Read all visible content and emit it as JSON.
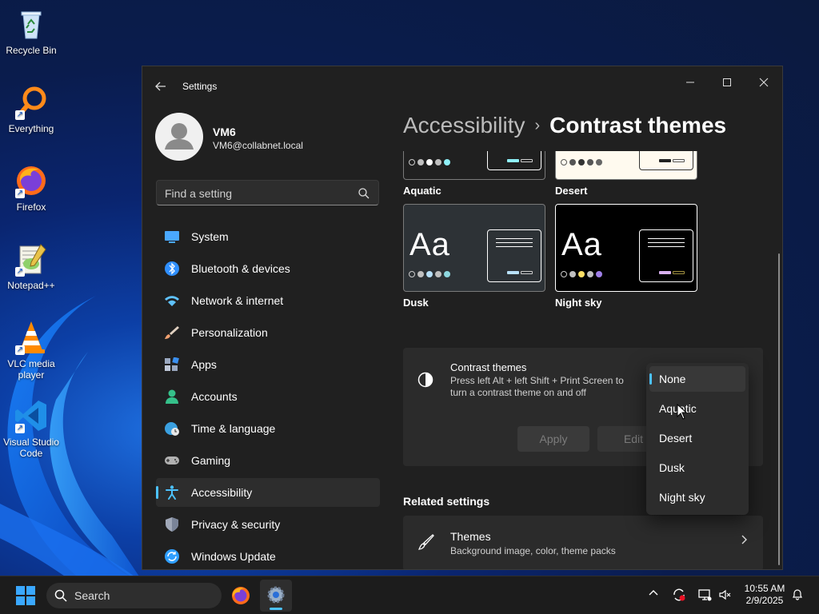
{
  "desktop": {
    "icons": [
      {
        "label": "Recycle Bin",
        "icon": "recycle-bin-icon"
      },
      {
        "label": "Everything",
        "icon": "everything-search-icon"
      },
      {
        "label": "Firefox",
        "icon": "firefox-icon"
      },
      {
        "label": "Notepad++",
        "icon": "notepadpp-icon"
      },
      {
        "label": "VLC media player",
        "icon": "vlc-icon"
      },
      {
        "label": "Visual Studio Code",
        "icon": "vscode-icon"
      }
    ]
  },
  "window": {
    "title": "Settings",
    "controls": {
      "minimize": "—",
      "maximize": "☐",
      "close": "✕"
    }
  },
  "profile": {
    "name": "VM6",
    "email": "VM6@collabnet.local"
  },
  "search": {
    "placeholder": "Find a setting"
  },
  "nav": {
    "items": [
      {
        "label": "System",
        "icon": "system-icon",
        "color": "#4aa8ff"
      },
      {
        "label": "Bluetooth & devices",
        "icon": "bluetooth-icon",
        "color": "#2f8fff"
      },
      {
        "label": "Network & internet",
        "icon": "wifi-icon",
        "color": "#5fc2ff"
      },
      {
        "label": "Personalization",
        "icon": "brush-icon",
        "color": "#f0a070"
      },
      {
        "label": "Apps",
        "icon": "apps-icon",
        "color": "#9aa8c0"
      },
      {
        "label": "Accounts",
        "icon": "accounts-icon",
        "color": "#35c08a"
      },
      {
        "label": "Time & language",
        "icon": "globe-clock-icon",
        "color": "#3aa0e0"
      },
      {
        "label": "Gaming",
        "icon": "gamepad-icon",
        "color": "#b0b0b0"
      },
      {
        "label": "Accessibility",
        "icon": "accessibility-icon",
        "color": "#4cc2ff"
      },
      {
        "label": "Privacy & security",
        "icon": "shield-icon",
        "color": "#a0a8b8"
      },
      {
        "label": "Windows Update",
        "icon": "update-icon",
        "color": "#2f9fff"
      }
    ],
    "active_index": 8
  },
  "breadcrumb": {
    "parent": "Accessibility",
    "separator": "›",
    "current": "Contrast themes"
  },
  "themes": {
    "preview_text": "Aa",
    "cards": [
      {
        "name": "Aquatic",
        "bg": "#202020",
        "fg": "#ffffff"
      },
      {
        "name": "Desert",
        "bg": "#fffaef",
        "fg": "#3d3d3d"
      },
      {
        "name": "Dusk",
        "bg": "#2d3236",
        "fg": "#ffffff"
      },
      {
        "name": "Night sky",
        "bg": "#000000",
        "fg": "#ffffff"
      }
    ]
  },
  "contrast_setting": {
    "title": "Contrast themes",
    "description": "Press left Alt + left Shift + Print Screen to turn a contrast theme on and off",
    "apply_label": "Apply",
    "edit_label": "Edit",
    "options": [
      "None",
      "Aquatic",
      "Desert",
      "Dusk",
      "Night sky"
    ],
    "selected": "None"
  },
  "related": {
    "title": "Related settings",
    "themes_title": "Themes",
    "themes_desc": "Background image, color, theme packs"
  },
  "taskbar": {
    "search_label": "Search",
    "time": "10:55 AM",
    "date": "2/9/2025"
  },
  "colors": {
    "accent": "#4cc2ff",
    "window_bg": "#202020",
    "card_bg": "#2b2b2b"
  }
}
